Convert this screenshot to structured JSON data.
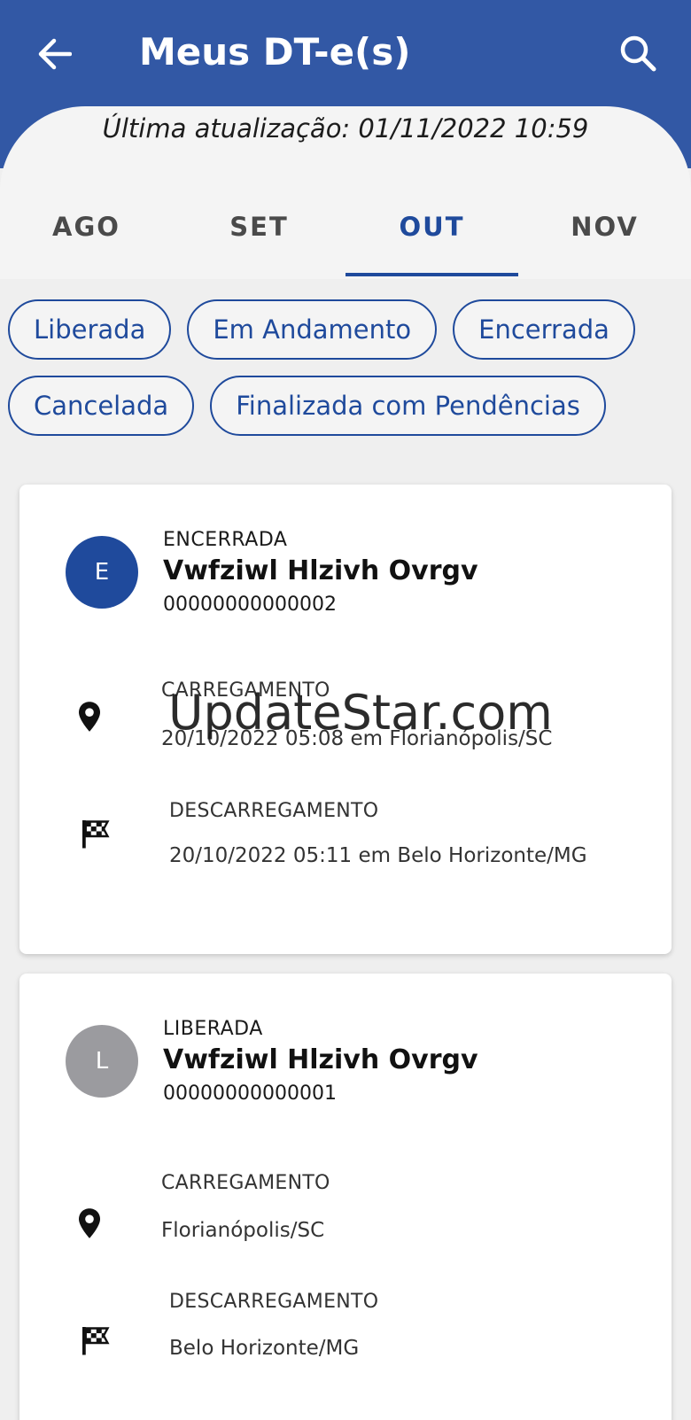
{
  "header": {
    "title": "Meus DT-e(s)",
    "back_icon": "arrow-left-icon",
    "search_icon": "search-icon",
    "background": "#3258a5"
  },
  "last_update": "Última atualização: 01/11/2022 10:59",
  "tabs": [
    {
      "label": "AGO",
      "active": false
    },
    {
      "label": "SET",
      "active": false
    },
    {
      "label": "OUT",
      "active": true
    },
    {
      "label": "NOV",
      "active": false
    }
  ],
  "filters": [
    "Liberada",
    "Em Andamento",
    "Encerrada",
    "Cancelada",
    "Finalizada com Pendências"
  ],
  "cards": [
    {
      "avatar_letter": "E",
      "avatar_color": "#1f4a9c",
      "status": "ENCERRADA",
      "name": "Vwfziwl Hlzivh Ovrgv",
      "code": "00000000000002",
      "loading_label": "CARREGAMENTO",
      "loading_value": "20/10/2022 05:08 em  Florianópolis/SC",
      "unloading_label": "DESCARREGAMENTO",
      "unloading_value": "20/10/2022 05:11 em  Belo Horizonte/MG"
    },
    {
      "avatar_letter": "L",
      "avatar_color": "#9b9b9f",
      "status": "LIBERADA",
      "name": "Vwfziwl Hlzivh Ovrgv",
      "code": "00000000000001",
      "loading_label": "CARREGAMENTO",
      "loading_value": "Florianópolis/SC",
      "unloading_label": "DESCARREGAMENTO",
      "unloading_value": "Belo Horizonte/MG"
    }
  ],
  "watermark": "UpdateStar.com"
}
